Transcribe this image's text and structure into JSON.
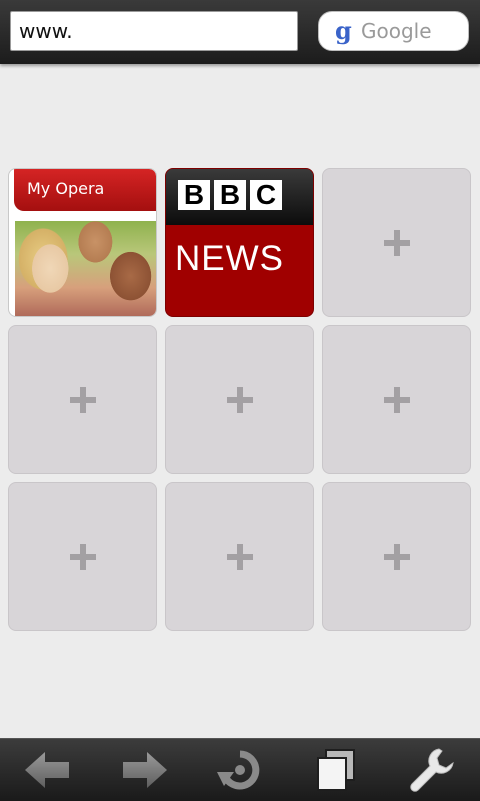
{
  "topbar": {
    "url_value": "www.",
    "search_placeholder": "Google",
    "search_engine_icon": "google-g-icon"
  },
  "speed_dial": {
    "tiles": [
      {
        "type": "site",
        "label": "My Opera"
      },
      {
        "type": "site",
        "bbc_letters": [
          "B",
          "B",
          "C"
        ],
        "label": "NEWS"
      },
      {
        "type": "empty",
        "icon": "plus-icon"
      },
      {
        "type": "empty",
        "icon": "plus-icon"
      },
      {
        "type": "empty",
        "icon": "plus-icon"
      },
      {
        "type": "empty",
        "icon": "plus-icon"
      },
      {
        "type": "empty",
        "icon": "plus-icon"
      },
      {
        "type": "empty",
        "icon": "plus-icon"
      },
      {
        "type": "empty",
        "icon": "plus-icon"
      }
    ]
  },
  "toolbar": {
    "buttons": [
      "back-arrow-icon",
      "forward-arrow-icon",
      "reload-icon",
      "tabs-icon",
      "wrench-icon"
    ]
  },
  "colors": {
    "accent_red": "#a00000",
    "tile_empty": "#d8d5d8",
    "bar_dark": "#1c1c1c"
  }
}
